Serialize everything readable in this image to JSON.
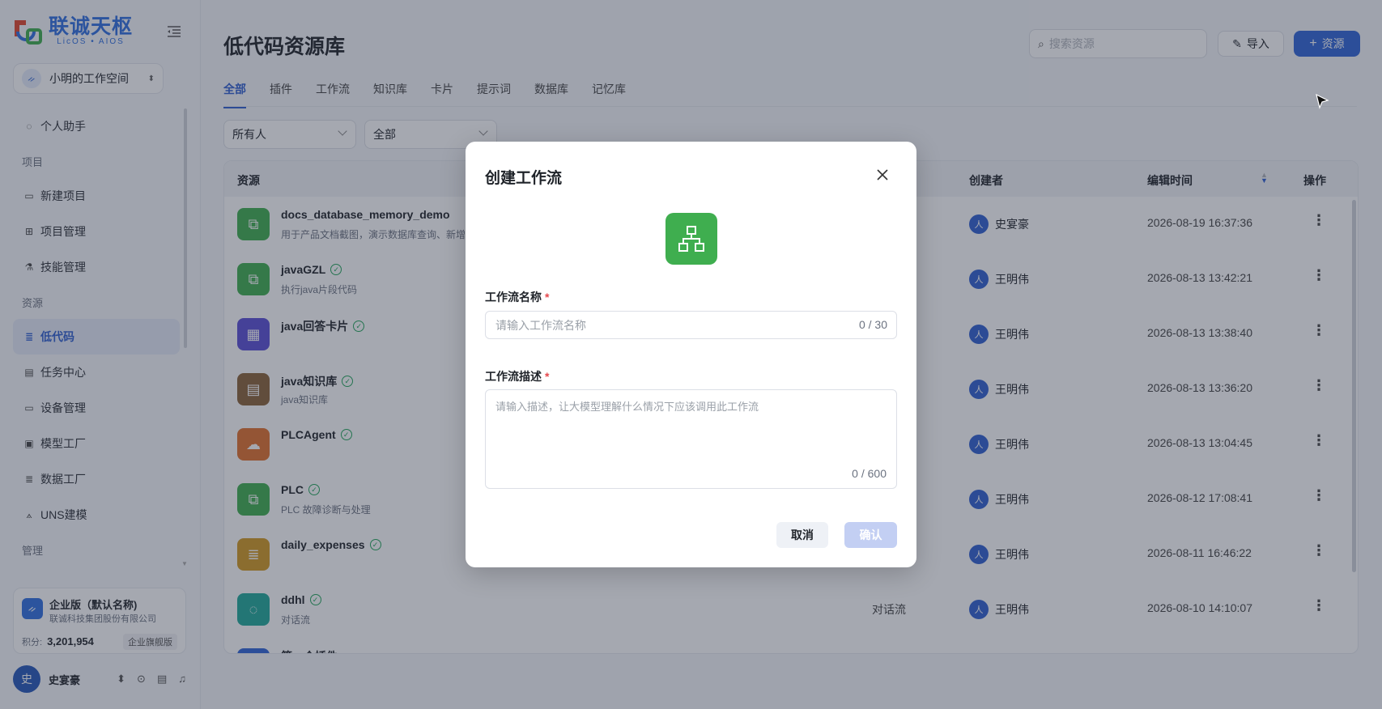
{
  "brand": {
    "name_cn": "联诚天枢",
    "name_en": "LicOS • AIOS"
  },
  "workspace": {
    "avatar": "ᨀ",
    "name": "小明的工作空间"
  },
  "sidebar": {
    "items": [
      {
        "icon": "chat-icon",
        "glyph": "◌",
        "label": "个人助手"
      },
      {
        "group": "项目"
      },
      {
        "icon": "monitor-icon",
        "glyph": "▭",
        "label": "新建项目"
      },
      {
        "icon": "grid-icon",
        "glyph": "⊞",
        "label": "项目管理"
      },
      {
        "icon": "flask-icon",
        "glyph": "⚗",
        "label": "技能管理"
      },
      {
        "group": "资源"
      },
      {
        "icon": "list-icon",
        "glyph": "≣",
        "label": "低代码",
        "active": true
      },
      {
        "icon": "calendar-icon",
        "glyph": "▤",
        "label": "任务中心"
      },
      {
        "icon": "device-icon",
        "glyph": "▭",
        "label": "设备管理"
      },
      {
        "icon": "model-icon",
        "glyph": "▣",
        "label": "模型工厂"
      },
      {
        "icon": "data-icon",
        "glyph": "≣",
        "label": "数据工厂"
      },
      {
        "icon": "graph-icon",
        "glyph": "⟑",
        "label": "UNS建模"
      },
      {
        "group": "管理"
      }
    ]
  },
  "enterprise": {
    "title": "企业版（默认名称)",
    "company": "联诚科技集团股份有限公司",
    "points_label": "积分:",
    "points": "3,201,954",
    "tier": "企业旗舰版"
  },
  "user": {
    "avatar": "史",
    "name": "史宴豪"
  },
  "header": {
    "title": "低代码资源库",
    "search_placeholder": "搜索资源",
    "import_label": "导入",
    "add_label": "资源"
  },
  "tabs": [
    "全部",
    "插件",
    "工作流",
    "知识库",
    "卡片",
    "提示词",
    "数据库",
    "记忆库"
  ],
  "filters": {
    "owner": "所有人",
    "status": "全部"
  },
  "table": {
    "columns": {
      "resource": "资源",
      "creator": "创建者",
      "edit_time": "编辑时间",
      "actions": "操作"
    },
    "rows": [
      {
        "name": "docs_database_memory_demo",
        "desc": "用于产品文档截图，演示数据库查询、新增",
        "icon": "workflow-icon",
        "glyph": "⧉",
        "color": "#3fae4f",
        "verified": false,
        "type": "",
        "creator": "史宴豪",
        "creator_av": "人",
        "time": "2026-08-19 16:37:36"
      },
      {
        "name": "javaGZL",
        "desc": "执行java片段代码",
        "icon": "workflow-icon",
        "glyph": "⧉",
        "color": "#3fae4f",
        "verified": true,
        "type": "",
        "creator": "王明伟",
        "creator_av": "人",
        "time": "2026-08-13 13:42:21"
      },
      {
        "name": "java回答卡片",
        "desc": "",
        "icon": "table-icon",
        "glyph": "▦",
        "color": "#5b4fd6",
        "verified": true,
        "type": "",
        "creator": "王明伟",
        "creator_av": "人",
        "time": "2026-08-13 13:38:40"
      },
      {
        "name": "java知识库",
        "desc": "java知识库",
        "icon": "document-icon",
        "glyph": "▤",
        "color": "#8a6337",
        "verified": true,
        "type": "",
        "creator": "王明伟",
        "creator_av": "人",
        "time": "2026-08-13 13:36:20"
      },
      {
        "name": "PLCAgent",
        "desc": "",
        "icon": "cloud-upload-icon",
        "glyph": "☁",
        "color": "#e2712c",
        "verified": true,
        "type": "",
        "creator": "王明伟",
        "creator_av": "人",
        "time": "2026-08-13 13:04:45"
      },
      {
        "name": "PLC",
        "desc": "PLC 故障诊断与处理",
        "icon": "workflow-icon",
        "glyph": "⧉",
        "color": "#3fae4f",
        "verified": true,
        "type": "",
        "creator": "王明伟",
        "creator_av": "人",
        "time": "2026-08-12 17:08:41"
      },
      {
        "name": "daily_expenses",
        "desc": "",
        "icon": "database-icon",
        "glyph": "≣",
        "color": "#d29a22",
        "verified": true,
        "type": "",
        "creator": "王明伟",
        "creator_av": "人",
        "time": "2026-08-11 16:46:22"
      },
      {
        "name": "ddhl",
        "desc": "对话流",
        "icon": "chatflow-icon",
        "glyph": "◌",
        "color": "#1faa9a",
        "verified": true,
        "type": "对话流",
        "creator": "王明伟",
        "creator_av": "人",
        "time": "2026-08-10 14:10:07"
      },
      {
        "name": "第一个插件",
        "desc": "",
        "icon": "plugin-icon",
        "glyph": "⬡",
        "color": "#2f65d8",
        "verified": false,
        "type": "",
        "creator": "",
        "creator_av": "",
        "time": ""
      }
    ]
  },
  "modal": {
    "title": "创建工作流",
    "name_label": "工作流名称",
    "name_placeholder": "请输入工作流名称",
    "name_value": "",
    "name_count": "0 / 30",
    "desc_label": "工作流描述",
    "desc_placeholder": "请输入描述，让大模型理解什么情况下应该调用此工作流",
    "desc_value": "",
    "desc_count": "0 / 600",
    "cancel_label": "取消",
    "confirm_label": "确认",
    "required_mark": "*"
  },
  "colors": {
    "accent": "#2f65d8",
    "workflow_green": "#3fae4f",
    "confirm_disabled": "#c3cff3",
    "required": "#e5484d"
  }
}
